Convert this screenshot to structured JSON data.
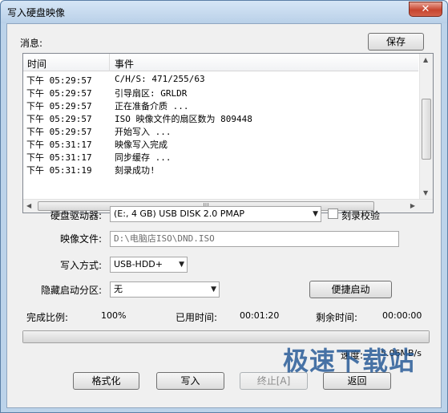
{
  "window": {
    "title": "写入硬盘映像",
    "close_glyph": "✕"
  },
  "log": {
    "label": "消息:",
    "save_label": "保存",
    "columns": [
      "时间",
      "事件"
    ],
    "rows": [
      {
        "time": "下午 05:29:57",
        "event": "C/H/S: 471/255/63"
      },
      {
        "time": "下午 05:29:57",
        "event": "引导扇区: GRLDR"
      },
      {
        "time": "下午 05:29:57",
        "event": "正在准备介质 ..."
      },
      {
        "time": "下午 05:29:57",
        "event": "ISO 映像文件的扇区数为 809448"
      },
      {
        "time": "下午 05:29:57",
        "event": "开始写入 ..."
      },
      {
        "time": "下午 05:31:17",
        "event": "映像写入完成"
      },
      {
        "time": "下午 05:31:17",
        "event": "同步缓存 ..."
      },
      {
        "time": "下午 05:31:19",
        "event": "刻录成功!"
      }
    ]
  },
  "form": {
    "drive_label": "硬盘驱动器:",
    "drive_value": "(E:, 4 GB)        USB DISK 2.0    PMAP",
    "verify_label": "刻录校验",
    "image_label": "映像文件:",
    "image_value": "D:\\电脑店ISO\\DND.ISO",
    "method_label": "写入方式:",
    "method_value": "USB-HDD+",
    "hidden_label": "隐藏启动分区:",
    "hidden_value": "无",
    "quick_boot_label": "便捷启动"
  },
  "status": {
    "progress_label": "完成比例:",
    "progress_value": "100%",
    "elapsed_label": "已用时间:",
    "elapsed_value": "00:01:20",
    "remaining_label": "剩余时间:",
    "remaining_value": "00:00:00",
    "speed_label": "速度:",
    "speed_value": "5.06MB/s",
    "progress_fraction": 1.0
  },
  "buttons": {
    "format": "格式化",
    "write": "写入",
    "stop": "终止[A]",
    "back": "返回"
  },
  "watermark": "极速下载站"
}
